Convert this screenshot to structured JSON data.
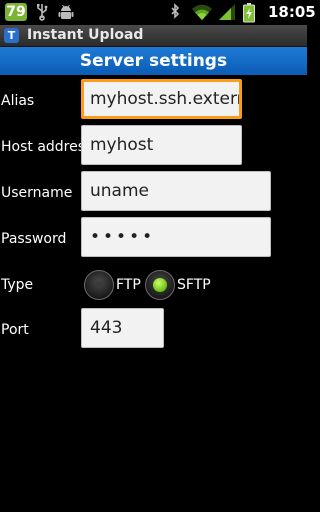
{
  "status_bar": {
    "notification_count": "79",
    "icons": [
      "usb-icon",
      "android-debug-icon",
      "bluetooth-icon",
      "wifi-icon",
      "signal-icon",
      "battery-charging-icon"
    ],
    "time": "18:05"
  },
  "title_bar": {
    "app_icon_letter": "T",
    "title": "Instant Upload"
  },
  "section": {
    "title": "Server settings"
  },
  "form": {
    "alias": {
      "label": "Alias",
      "value": "myhost.ssh.extern"
    },
    "host": {
      "label": "Host address",
      "value": "myhost"
    },
    "username": {
      "label": "Username",
      "value": "uname"
    },
    "password": {
      "label": "Password",
      "value": "•••••"
    },
    "type": {
      "label": "Type",
      "options": [
        {
          "label": "FTP",
          "selected": false
        },
        {
          "label": "SFTP",
          "selected": true
        }
      ]
    },
    "port": {
      "label": "Port",
      "value": "443"
    }
  },
  "colors": {
    "header_blue": "#0b5cb5",
    "focus_orange": "#ff9b1a",
    "radio_checked_green": "#6cc010",
    "notification_green": "#7bb334"
  }
}
